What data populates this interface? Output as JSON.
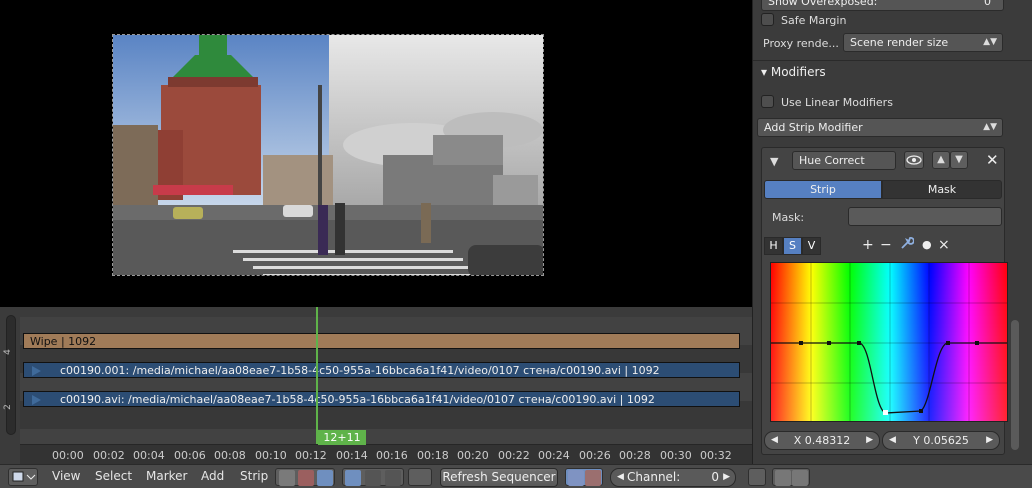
{
  "panel": {
    "show_overexposed_label": "Show Overexposed:",
    "show_overexposed_value": "0",
    "safe_margin_label": "Safe Margin",
    "proxy_render_label": "Proxy rende...",
    "proxy_render_value": "Scene render size",
    "modifiers_title": "Modifiers",
    "use_linear_modifiers_label": "Use Linear Modifiers",
    "add_strip_modifier_label": "Add Strip Modifier",
    "modifier": {
      "name": "Hue Correct",
      "tabs": [
        "Strip",
        "Mask"
      ],
      "mask_label": "Mask:",
      "channels": [
        "H",
        "S",
        "V"
      ],
      "tools": [
        "+",
        "−",
        "wrench-icon",
        "●",
        "×"
      ],
      "x_label": "X 0.48312",
      "y_label": "Y 0.05625"
    }
  },
  "sequencer": {
    "strips": [
      {
        "label": "Wipe | 1092",
        "type": "wipe"
      },
      {
        "label": "c00190.001: /media/michael/aa08eae7-1b58-4c50-955a-16bbca6a1f41/video/0107 стена/c00190.avi | 1092",
        "type": "movie"
      },
      {
        "label": "c00190.avi: /media/michael/aa08eae7-1b58-4c50-955a-16bbca6a1f41/video/0107 стена/c00190.avi | 1092",
        "type": "movie"
      }
    ],
    "channel_numbers": [
      "4",
      "2"
    ],
    "current_frame": "12+11",
    "ruler_ticks": [
      "00:00",
      "00:02",
      "00:04",
      "00:06",
      "00:08",
      "00:10",
      "00:12",
      "00:14",
      "00:16",
      "00:18",
      "00:20",
      "00:22",
      "00:24",
      "00:26",
      "00:28",
      "00:30",
      "00:32"
    ]
  },
  "header": {
    "menus": [
      "View",
      "Select",
      "Marker",
      "Add",
      "Strip"
    ],
    "refresh_label": "Refresh Sequencer",
    "channel_label": "Channel:",
    "channel_value": "0"
  },
  "colors": {
    "wipe_strip": "#a07b58",
    "movie_strip": "#2c4d74",
    "playhead": "#5fb34a",
    "selected_tab": "#5680c2"
  }
}
